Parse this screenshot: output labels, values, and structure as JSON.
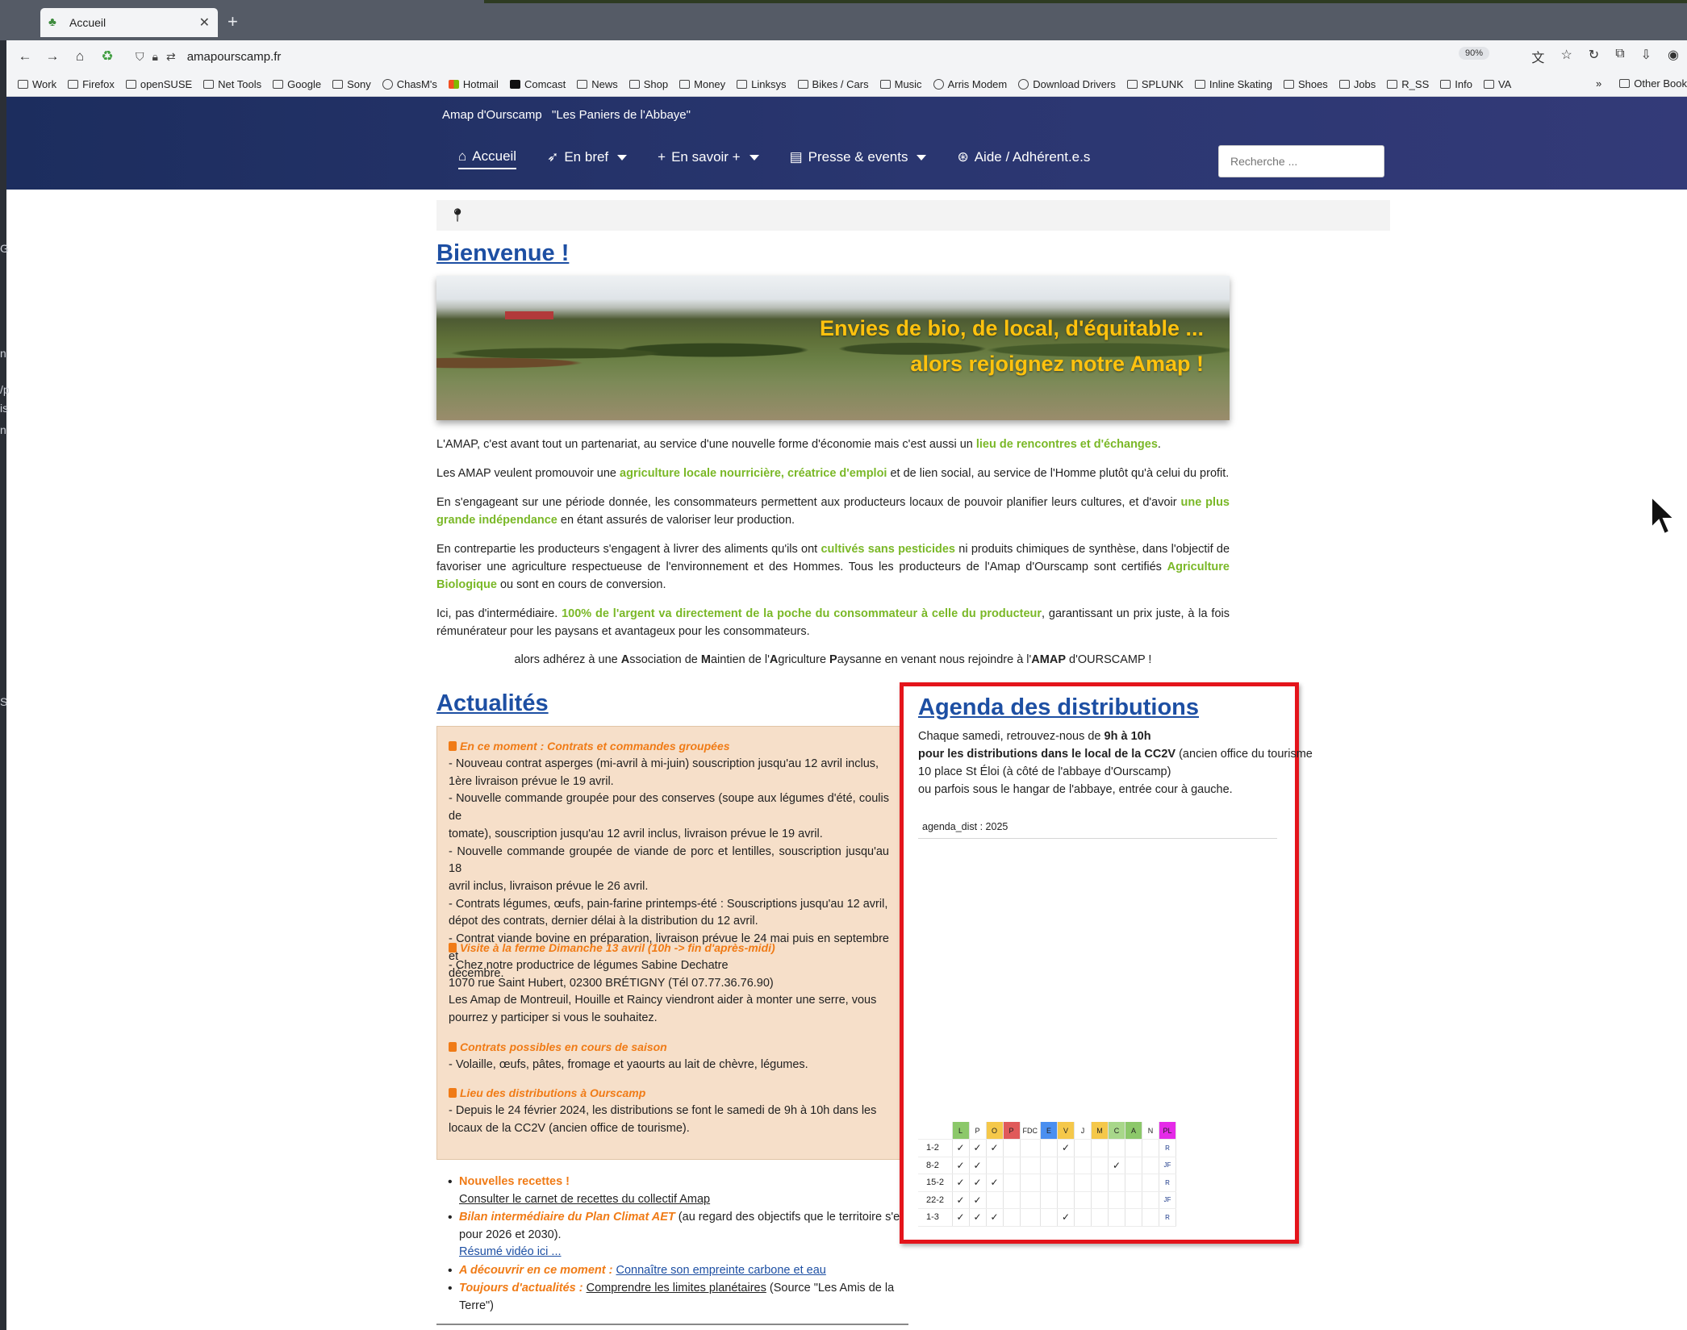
{
  "browser": {
    "tab_title": "Accueil",
    "url": "amapourscamp.fr",
    "zoom": "90%",
    "bookmarks": [
      {
        "label": "Work",
        "icon": "folder-icon"
      },
      {
        "label": "Firefox",
        "icon": "folder-icon"
      },
      {
        "label": "openSUSE",
        "icon": "folder-icon"
      },
      {
        "label": "Net Tools",
        "icon": "folder-icon"
      },
      {
        "label": "Google",
        "icon": "folder-icon"
      },
      {
        "label": "Sony",
        "icon": "folder-icon"
      },
      {
        "label": "ChasM's",
        "icon": "globe-icon"
      },
      {
        "label": "Hotmail",
        "icon": "microsoft-icon"
      },
      {
        "label": "Comcast",
        "icon": "x-icon"
      },
      {
        "label": "News",
        "icon": "folder-icon"
      },
      {
        "label": "Shop",
        "icon": "folder-icon"
      },
      {
        "label": "Money",
        "icon": "folder-icon"
      },
      {
        "label": "Linksys",
        "icon": "folder-icon"
      },
      {
        "label": "Bikes / Cars",
        "icon": "folder-icon"
      },
      {
        "label": "Music",
        "icon": "folder-icon"
      },
      {
        "label": "Arris Modem",
        "icon": "globe-icon"
      },
      {
        "label": "Download Drivers",
        "icon": "globe-icon"
      },
      {
        "label": "SPLUNK",
        "icon": "folder-icon"
      },
      {
        "label": "Inline Skating",
        "icon": "folder-icon"
      },
      {
        "label": "Shoes",
        "icon": "folder-icon"
      },
      {
        "label": "Jobs",
        "icon": "folder-icon"
      },
      {
        "label": "R_SS",
        "icon": "folder-icon"
      },
      {
        "label": "Info",
        "icon": "folder-icon"
      },
      {
        "label": "VA",
        "icon": "folder-icon"
      }
    ],
    "other_bookmarks": "Other Book"
  },
  "header": {
    "brand": "Amap d'Ourscamp",
    "tagline": "\"Les Paniers de l'Abbaye\"",
    "menu": [
      {
        "label": "Accueil",
        "icon": "home-icon",
        "dropdown": false,
        "active": true
      },
      {
        "label": "En bref",
        "icon": "rocket-icon",
        "dropdown": true
      },
      {
        "label": "En savoir +",
        "icon": "plus-icon",
        "dropdown": true
      },
      {
        "label": "Presse & events",
        "icon": "newspaper-icon",
        "dropdown": true
      },
      {
        "label": "Aide / Adhérent.e.s",
        "icon": "lifebuoy-icon",
        "dropdown": false
      }
    ],
    "search_placeholder": "Recherche ..."
  },
  "welcome": {
    "title": "Bienvenue !",
    "hero_line1": "Envies de bio, de local, d'équitable ...",
    "hero_line2": "alors rejoignez notre Amap !",
    "p1a": "L'AMAP, c'est avant tout un partenariat, au service d'une nouvelle forme d'économie mais c'est aussi un ",
    "p1b": "lieu de rencontres et d'échanges",
    "p1c": ".",
    "p2a": "Les AMAP veulent promouvoir une ",
    "p2b": "agriculture locale nourricière, créatrice d'emploi",
    "p2c": " et de lien social, au service de l'Homme plutôt qu'à celui du profit.",
    "p3a": "En s'engageant sur une période donnée, les consommateurs permettent aux producteurs locaux de pouvoir planifier leurs cultures, et d'avoir ",
    "p3b": "une plus grande indépendance",
    "p3c": " en étant assurés de valoriser leur production.",
    "p4a": "En contrepartie les producteurs s'engagent à livrer des aliments qu'ils ont ",
    "p4b": "cultivés sans pesticides",
    "p4c": " ni produits chimiques de synthèse, dans l'objectif de favoriser une agriculture respectueuse de l'environnement et des Hommes. Tous les producteurs de l'Amap d'Ourscamp sont certifiés ",
    "p4d": "Agriculture Biologique",
    "p4e": " ou sont en cours de conversion.",
    "p5a": "Ici, pas d'intermédiaire. ",
    "p5b": "100% de l'argent va directement de la poche du consommateur à celle du producteur",
    "p5c": ", garantissant un prix juste, à la fois rémunérateur pour les paysans et avantageux pour les consommateurs.",
    "p6": [
      "alors adhérez à une ",
      "A",
      "ssociation de ",
      "M",
      "aintien de l'",
      "A",
      "griculture ",
      "P",
      "aysanne en venant nous rejoindre à l'",
      "AMAP",
      " d'OURSCAMP !"
    ]
  },
  "news": {
    "title": "Actualités",
    "h1": "En ce moment : Contrats et commandes groupées",
    "b1": [
      "- Nouveau contrat asperges (mi-avril à mi-juin) souscription jusqu'au 12 avril inclus,",
      "1ère livraison prévue le 19 avril.",
      "- Nouvelle commande groupée pour des conserves (soupe aux légumes d'été, coulis de",
      "tomate), souscription jusqu'au 12 avril inclus, livraison prévue le 19 avril.",
      "- Nouvelle commande groupée de viande de porc et lentilles, souscription jusqu'au 18",
      "avril inclus, livraison prévue le 26 avril.",
      "- Contrats légumes, œufs, pain-farine printemps-été : Souscriptions jusqu'au 12 avril,",
      "dépot des contrats, dernier délai à la distribution du 12 avril.",
      "- Contrat viande bovine en préparation, livraison prévue le 24 mai puis en septembre et",
      "décembre."
    ],
    "h2": "Visite à la ferme Dimanche 13 avril (10h -> fin d'après-midi)",
    "b2": [
      "- Chez notre productrice de légumes Sabine Dechatre",
      "1070 rue Saint Hubert, 02300 BRÉTIGNY (Tél 07.77.36.76.90)",
      "Les Amap de Montreuil, Houille et Raincy viendront aider à monter une serre, vous",
      "pourrez y participer si vous le souhaitez."
    ],
    "h3": "Contrats possibles en cours de saison",
    "b3": [
      "- Volaille, œufs, pâtes, fromage et yaourts au lait de chèvre, légumes."
    ],
    "h4": "Lieu des distributions à Ourscamp",
    "b4": [
      "- Depuis le 24 février 2024, les distributions se font le samedi de 9h à 10h dans les",
      "locaux de la CC2V (ancien office de tourisme)."
    ]
  },
  "extra": {
    "i1_label": "Nouvelles recettes !",
    "i1_link": "Consulter le carnet de recettes du collectif Amap",
    "i2_label": "Bilan intermédiaire du Plan Climat AET",
    "i2_text1": " (au regard des objectifs que le territoire s'est fixé",
    "i2_text2": "pour 2026 et 2030).",
    "i2_link": "Résumé vidéo ici ...",
    "i3_label": "A découvrir en ce moment : ",
    "i3_link": "Connaître son empreinte carbone et eau",
    "i4_label": "Toujours d'actualités : ",
    "i4_link": "Comprendre les limites planétaires",
    "i4_text1": " (Source \"Les Amis de la",
    "i4_text2": "Terre\")"
  },
  "agenda": {
    "title": "Agenda des distributions",
    "l1a": "Chaque samedi, retrouvez-nous de ",
    "l1b": "9h à 10h",
    "l2a": "pour les distributions dans le local de la CC2V",
    "l2b": " (ancien office du tourisme",
    "l3": "10 place St Éloi (à côté de l'abbaye d'Ourscamp)",
    "l4": "ou parfois sous le hangar de l'abbaye, entrée cour à gauche.",
    "doc_label": "agenda_dist : 2025",
    "columns": [
      {
        "code": "L",
        "color": "#8cc86a"
      },
      {
        "code": "P",
        "color": ""
      },
      {
        "code": "O",
        "color": "#f5c84a"
      },
      {
        "code": "P",
        "color": "#e05a5a"
      },
      {
        "code": "FDC",
        "color": ""
      },
      {
        "code": "E",
        "color": "#4a8ff0"
      },
      {
        "code": "V",
        "color": "#f5c84a"
      },
      {
        "code": "J",
        "color": ""
      },
      {
        "code": "M",
        "color": "#f5c84a"
      },
      {
        "code": "C",
        "color": "#a8d78a"
      },
      {
        "code": "A",
        "color": "#8cc86a"
      },
      {
        "code": "N",
        "color": ""
      },
      {
        "code": "PL",
        "color": "#e52ae8"
      }
    ],
    "rows": [
      {
        "date": "1-2",
        "marks": [
          "✓",
          "✓",
          "✓",
          "",
          "",
          "",
          "✓",
          "",
          "",
          "",
          "",
          "",
          ""
        ],
        "resp": "R"
      },
      {
        "date": "8-2",
        "marks": [
          "✓",
          "✓",
          "",
          "",
          "",
          "",
          "",
          "",
          "",
          "✓",
          "",
          "",
          ""
        ],
        "resp": "JF"
      },
      {
        "date": "15-2",
        "marks": [
          "✓",
          "✓",
          "✓",
          "",
          "",
          "",
          "",
          "",
          "",
          "",
          "",
          "",
          ""
        ],
        "resp": "R"
      },
      {
        "date": "22-2",
        "marks": [
          "✓",
          "✓",
          "",
          "",
          "",
          "",
          "",
          "",
          "",
          "",
          "",
          "",
          ""
        ],
        "resp": "JF"
      },
      {
        "date": "1-3",
        "marks": [
          "✓",
          "✓",
          "✓",
          "",
          "",
          "",
          "✓",
          "",
          "",
          "",
          "",
          "",
          ""
        ],
        "resp": "R"
      }
    ]
  }
}
